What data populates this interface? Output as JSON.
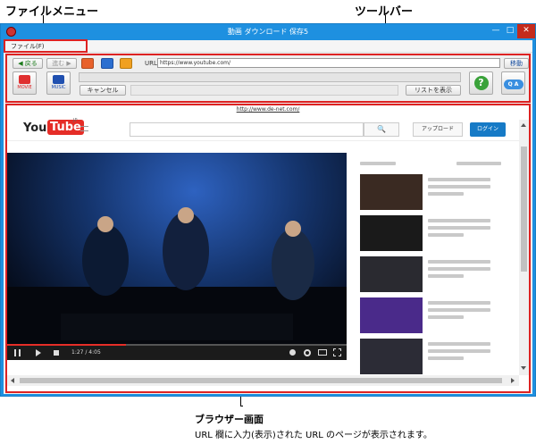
{
  "callouts": {
    "file_menu": "ファイルメニュー",
    "toolbar": "ツールバー",
    "browser": "ブラウザー画面",
    "browser_desc": "URL 欄に入力(表示)された URL のページが表示されます。"
  },
  "window": {
    "title": "動画 ダウンロード 保存5",
    "min_glyph": "—",
    "max_glyph": "□",
    "close_glyph": "✕"
  },
  "menu": {
    "file": "ファイル(F)"
  },
  "toolbar": {
    "back": "◀ 戻る",
    "forward": "進む ▶",
    "url_label": "URL",
    "url_value": "https://www.youtube.com/",
    "go": "移動",
    "movie": "MOVIE",
    "music": "MUSIC",
    "cancel": "キャンセル",
    "list_show": "リストを表示",
    "help_glyph": "?",
    "qa": "Q A"
  },
  "browser": {
    "page_url": "http://www.de-net.com/",
    "yt": {
      "logo_you": "You",
      "logo_tube": "Tube",
      "logo_jp": "JP",
      "upload": "アップロード",
      "login": "ログイン",
      "search_glyph": "🔍"
    },
    "video": {
      "time": "1:27 / 4:05",
      "progress": 0.35
    },
    "sidebar_thumb_colors": [
      "#3a2a22",
      "#1a1a1a",
      "#2a2a30",
      "#4a2a8a",
      "#2c2c36"
    ]
  },
  "colors": {
    "window_blue": "#1e90e0",
    "callout_red": "#dd2222",
    "yt_red": "#e52d27",
    "yt_blue": "#167ac6"
  }
}
